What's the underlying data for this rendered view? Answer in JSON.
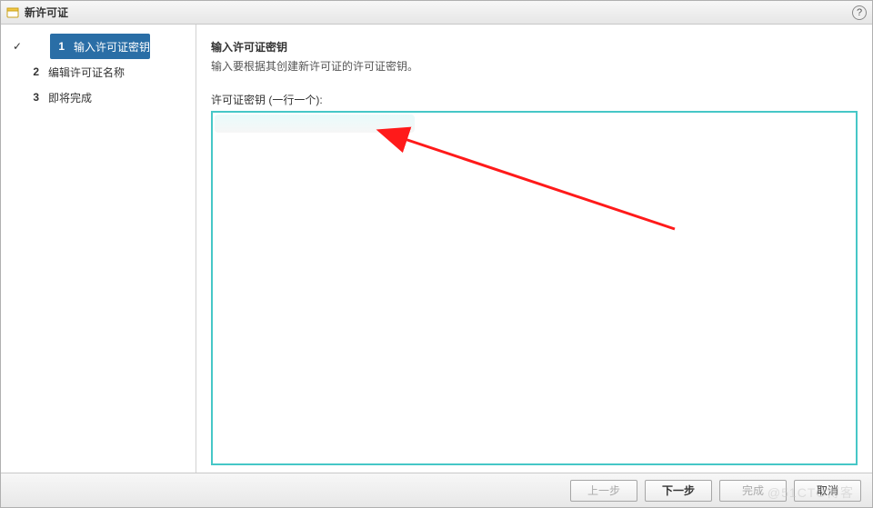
{
  "titlebar": {
    "title": "新许可证"
  },
  "sidebar": {
    "steps": [
      {
        "num": "1",
        "label": "输入许可证密钥",
        "active": true,
        "checked": true
      },
      {
        "num": "2",
        "label": "编辑许可证名称",
        "active": false,
        "checked": false
      },
      {
        "num": "3",
        "label": "即将完成",
        "active": false,
        "checked": false
      }
    ]
  },
  "content": {
    "heading": "输入许可证密钥",
    "subheading": "输入要根据其创建新许可证的许可证密钥。",
    "field_label": "许可证密钥 (一行一个):",
    "keys_value": ""
  },
  "footer": {
    "back": "上一步",
    "next": "下一步",
    "finish": "完成",
    "cancel": "取消"
  },
  "watermark": "@51CTO博客"
}
